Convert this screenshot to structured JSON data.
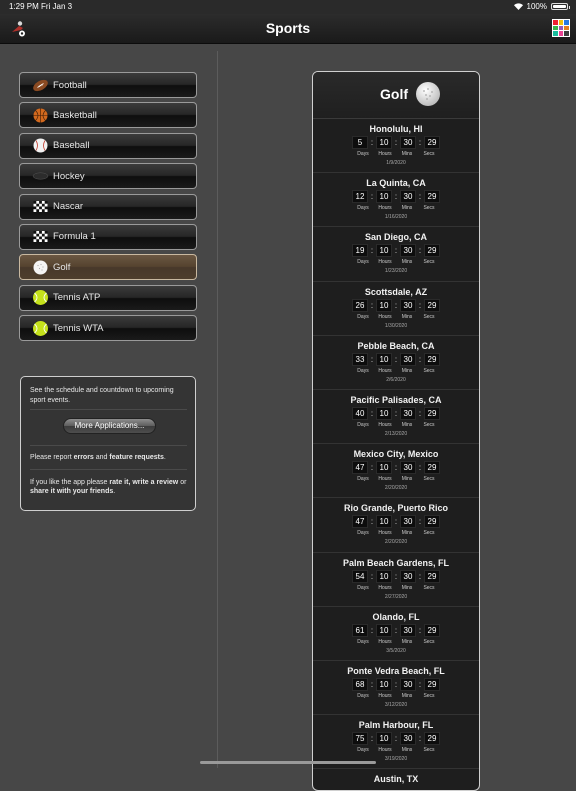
{
  "status_bar": {
    "time": "1:29 PM",
    "date": "Fri Jan 3",
    "battery": "100%",
    "battery_level": 1.0
  },
  "navbar": {
    "title": "Sports",
    "left_icon": "sports-figure-icon",
    "right_icon": "apps-grid-icon"
  },
  "sports": [
    {
      "label": "Football",
      "icon": "football-icon",
      "selected": false
    },
    {
      "label": "Basketball",
      "icon": "basketball-icon",
      "selected": false
    },
    {
      "label": "Baseball",
      "icon": "baseball-icon",
      "selected": false
    },
    {
      "label": "Hockey",
      "icon": "hockey-puck-icon",
      "selected": false
    },
    {
      "label": "Nascar",
      "icon": "checkered-flag-icon",
      "selected": false
    },
    {
      "label": "Formula 1",
      "icon": "checkered-flag-icon",
      "selected": false
    },
    {
      "label": "Golf",
      "icon": "golf-ball-icon",
      "selected": true
    },
    {
      "label": "Tennis ATP",
      "icon": "tennis-ball-icon",
      "selected": false
    },
    {
      "label": "Tennis WTA",
      "icon": "tennis-ball-icon",
      "selected": false
    }
  ],
  "info": {
    "description": "See the schedule and countdown to upcoming sport events.",
    "more_button": "More Applications...",
    "report_pre": "Please report ",
    "report_errors": "errors",
    "report_and": " and ",
    "report_features": "feature requests",
    "report_post": ".",
    "like_pre": "If you like the app please ",
    "like_rate": "rate it, write a review",
    "like_or": " or ",
    "like_share": "share it with your friends",
    "like_post": "."
  },
  "panel": {
    "title": "Golf",
    "unit_labels": [
      "Days",
      "Hours",
      "Mins",
      "Secs"
    ],
    "events": [
      {
        "location": "Honolulu, HI",
        "days": "5",
        "hours": "10",
        "mins": "30",
        "secs": "29",
        "date": "1/9/2020"
      },
      {
        "location": "La Quinta, CA",
        "days": "12",
        "hours": "10",
        "mins": "30",
        "secs": "29",
        "date": "1/16/2020"
      },
      {
        "location": "San Diego, CA",
        "days": "19",
        "hours": "10",
        "mins": "30",
        "secs": "29",
        "date": "1/23/2020"
      },
      {
        "location": "Scottsdale, AZ",
        "days": "26",
        "hours": "10",
        "mins": "30",
        "secs": "29",
        "date": "1/30/2020"
      },
      {
        "location": "Pebble Beach, CA",
        "days": "33",
        "hours": "10",
        "mins": "30",
        "secs": "29",
        "date": "2/6/2020"
      },
      {
        "location": "Pacific Palisades, CA",
        "days": "40",
        "hours": "10",
        "mins": "30",
        "secs": "29",
        "date": "2/13/2020"
      },
      {
        "location": "Mexico City, Mexico",
        "days": "47",
        "hours": "10",
        "mins": "30",
        "secs": "29",
        "date": "2/20/2020"
      },
      {
        "location": "Rio Grande, Puerto Rico",
        "days": "47",
        "hours": "10",
        "mins": "30",
        "secs": "29",
        "date": "2/20/2020"
      },
      {
        "location": "Palm Beach Gardens, FL",
        "days": "54",
        "hours": "10",
        "mins": "30",
        "secs": "29",
        "date": "2/27/2020"
      },
      {
        "location": "Olando, FL",
        "days": "61",
        "hours": "10",
        "mins": "30",
        "secs": "29",
        "date": "3/5/2020"
      },
      {
        "location": "Ponte Vedra Beach, FL",
        "days": "68",
        "hours": "10",
        "mins": "30",
        "secs": "29",
        "date": "3/12/2020"
      },
      {
        "location": "Palm Harbour, FL",
        "days": "75",
        "hours": "10",
        "mins": "30",
        "secs": "29",
        "date": "3/19/2020"
      },
      {
        "location": "Austin, TX",
        "days": "",
        "hours": "",
        "mins": "",
        "secs": "",
        "date": ""
      }
    ]
  },
  "colors": {
    "selected_row": "#55432f",
    "background": "#474747",
    "panel": "#1e1e1e"
  }
}
